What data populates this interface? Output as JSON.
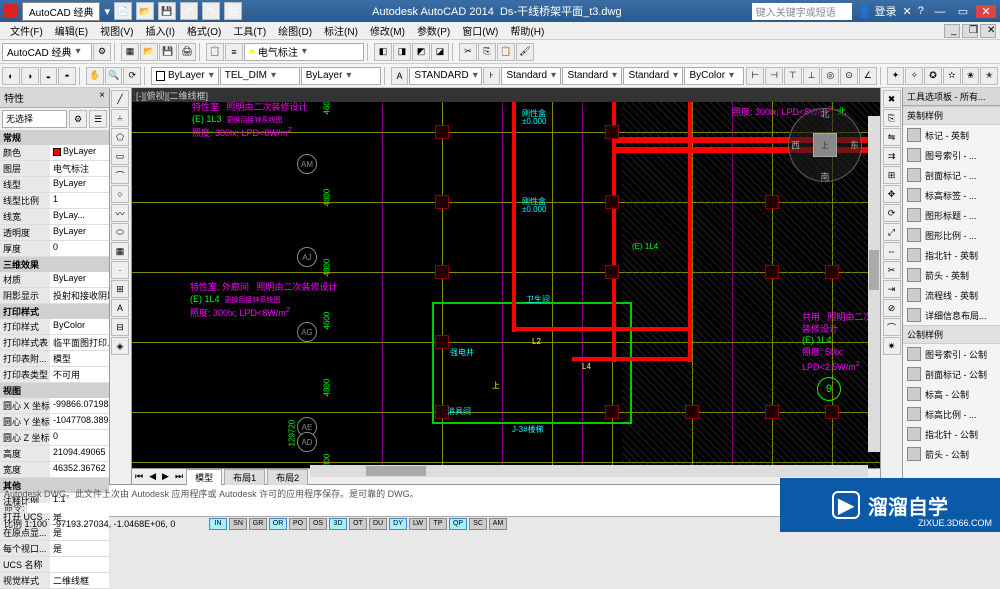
{
  "titlebar": {
    "workspace": "AutoCAD 经典",
    "app_title": "Autodesk AutoCAD 2014",
    "doc_title": "Ds-干线桥架平面_t3.dwg",
    "search_placeholder": "键入关键字或短语",
    "login": "登录",
    "min": "—",
    "max": "▭",
    "close": "✕"
  },
  "menubar": {
    "items": [
      "文件(F)",
      "编辑(E)",
      "视图(V)",
      "插入(I)",
      "格式(O)",
      "工具(T)",
      "绘图(D)",
      "标注(N)",
      "修改(M)",
      "参数(P)",
      "窗口(W)",
      "帮助(H)"
    ]
  },
  "toolbar1": {
    "workspace_dd": "AutoCAD 经典",
    "layer_status": "电气标注"
  },
  "toolbar2": {
    "color_dd": "ByLayer",
    "lt_dd": "TEL_DIM",
    "lw_dd": "ByLayer",
    "ts_dd": "STANDARD",
    "ds1_dd": "Standard",
    "ds2_dd": "Standard",
    "ds3_dd": "Standard",
    "bycolor_dd": "ByColor"
  },
  "props": {
    "title": "特性",
    "filter": "无选择",
    "sections": {
      "general": {
        "hdr": "常规",
        "rows": [
          {
            "k": "颜色",
            "v": "ByLayer",
            "swatch": true
          },
          {
            "k": "图层",
            "v": "电气标注"
          },
          {
            "k": "线型",
            "v": "ByLayer"
          },
          {
            "k": "线型比例",
            "v": "1"
          },
          {
            "k": "线宽",
            "v": "ByLay..."
          },
          {
            "k": "透明度",
            "v": "ByLayer"
          },
          {
            "k": "厚度",
            "v": "0"
          }
        ]
      },
      "visual": {
        "hdr": "三维效果",
        "rows": [
          {
            "k": "材质",
            "v": "ByLayer"
          },
          {
            "k": "阴影显示",
            "v": "投射和接收阴影"
          }
        ]
      },
      "plot": {
        "hdr": "打印样式",
        "rows": [
          {
            "k": "打印样式",
            "v": "ByColor"
          },
          {
            "k": "打印样式表",
            "v": "临平面图打印..."
          },
          {
            "k": "打印表附...",
            "v": "模型"
          },
          {
            "k": "打印表类型",
            "v": "不可用"
          }
        ]
      },
      "view": {
        "hdr": "视图",
        "rows": [
          {
            "k": "圆心 X 坐标",
            "v": "-99866.07198"
          },
          {
            "k": "圆心 Y 坐标",
            "v": "-1047708.389..."
          },
          {
            "k": "圆心 Z 坐标",
            "v": "0"
          },
          {
            "k": "高度",
            "v": "21094.49065"
          },
          {
            "k": "宽度",
            "v": "46352.36762"
          }
        ]
      },
      "misc": {
        "hdr": "其他",
        "rows": [
          {
            "k": "注释比例",
            "v": "1:1"
          },
          {
            "k": "打开 UCS ...",
            "v": "是"
          },
          {
            "k": "在原点显...",
            "v": "是"
          },
          {
            "k": "每个视口...",
            "v": "是"
          },
          {
            "k": "UCS 名称",
            "v": ""
          },
          {
            "k": "视觉样式",
            "v": "二维线框"
          }
        ]
      }
    }
  },
  "canvas": {
    "top_tab": "[-][俯视][二维线框]",
    "dims_v": [
      "4600",
      "4800",
      "4800",
      "4600",
      "4800",
      "4800"
    ],
    "grid_bubbles_left": [
      "AM",
      "AJ",
      "AG",
      "AE",
      "AD"
    ],
    "elev_label": "±0.000",
    "elev_label2": "刚性盒",
    "elec1": {
      "l1": "特性室",
      "l2": "照明由二次装修设计",
      "l3": "(E) 1L3",
      "l4": "更换后接锌系统图",
      "l5": "照度:  300lx; LPD<8W/m",
      "sup": "2"
    },
    "elec2": {
      "l1": "特性室; 外廊间",
      "l2": "照明由二次装修设计",
      "l3": "(E) 1L4",
      "l4": "更换后接锌系统图",
      "l5": "照度:  300lx; LPD<8W/m",
      "sup": "2"
    },
    "elec_top_right": {
      "l1": "照度:",
      "l2": "300lx; LPD<8W/m",
      "sup": "2",
      "tag": "北"
    },
    "elec3": {
      "l1": "共用",
      "l2": "照明由二次装修设计",
      "l3": "(E) 1L4",
      "l5": "照度:  50lx; LPD<2.5W/m",
      "sup": "2"
    },
    "labels": {
      "L2": "L2",
      "L4": "L4",
      "up": "上",
      "room1": "强电井",
      "room2": "消具间",
      "stair": "J-3#楼梯",
      "wc": "卫生间",
      "e1l4": "(E) 1L4"
    },
    "compass": {
      "n": "北",
      "s": "南",
      "e": "东",
      "w": "西",
      "top": "上"
    },
    "dim_long": "129720",
    "circle9": "9",
    "bottom_tabs": {
      "model": "模型",
      "l1": "布局1",
      "l2": "布局2"
    }
  },
  "palette": {
    "title": "工具选项板 - 所有...",
    "section1": "英制样例",
    "items1": [
      "标记 - 英制",
      "图号索引 - ...",
      "剖面标记 - ...",
      "标高标签 - ...",
      "图形标题 - ...",
      "图形比例 - ...",
      "指北针 - 英制",
      "箭头 - 英制",
      "流程线 - 英制",
      "详细信息布局..."
    ],
    "section2": "公制样例",
    "items2": [
      "图号索引 - 公制",
      "剖面标记 - 公制",
      "标高 - 公制",
      "标高比例 - ...",
      "指北针 - 公制",
      "箭头 - 公制"
    ]
  },
  "cmdline": {
    "hist": "Autodesk DWG。此文件上次由 Autodesk 应用程序或 Autodesk 许可的应用程序保存。是可靠的 DWG。",
    "prompt": "命令:"
  },
  "statusbar": {
    "scale_label": "比例 1:100",
    "coords": "-97193.27034, -1.0468E+06, 0",
    "toggles": [
      "INF",
      "SNA",
      "GRI",
      "ORT",
      "POL",
      "OSN",
      "3DO",
      "OTR",
      "DUC",
      "DYN",
      "LWT",
      "TPY",
      "QP",
      "SC",
      "AM"
    ]
  },
  "watermark": {
    "brand": "溜溜自学",
    "url": "ZIXUE.3D66.COM"
  }
}
